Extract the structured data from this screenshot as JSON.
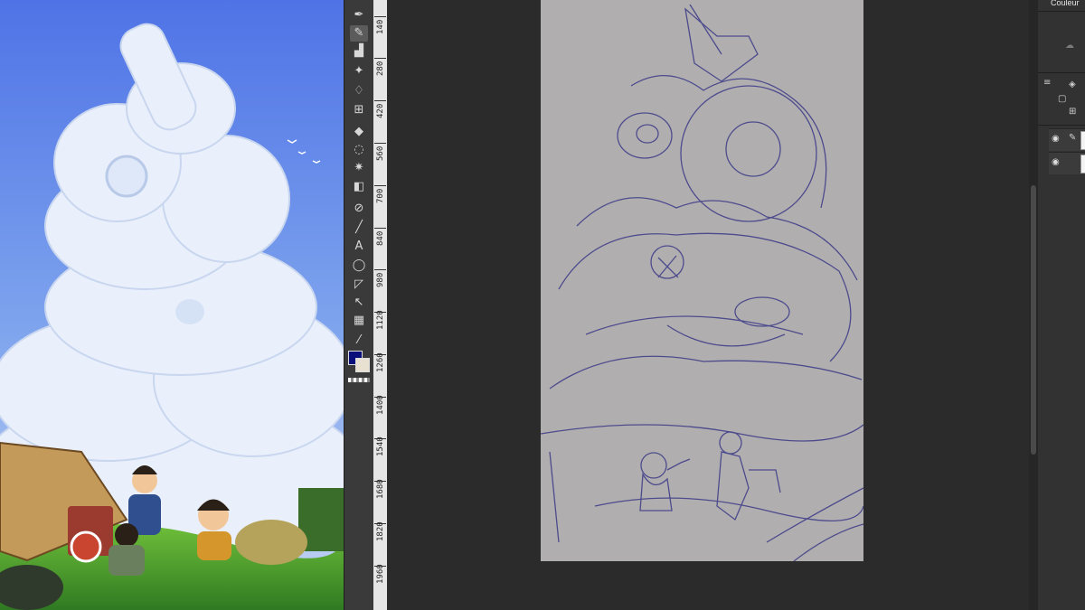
{
  "panel": {
    "tab_label": "Couleur"
  },
  "ruler": {
    "ticks": [
      "140",
      "280",
      "420",
      "560",
      "700",
      "840",
      "980",
      "1120",
      "1260",
      "1400",
      "1540",
      "1680",
      "1820",
      "1960"
    ]
  },
  "colors": {
    "main": "#0b0f7a",
    "sub": "#e8e0d0"
  },
  "icons": {
    "tools": [
      "pen-icon",
      "pencil-icon",
      "brush-icon",
      "airbrush-icon",
      "blend-icon",
      "grid-icon",
      "fill-icon",
      "lasso-icon",
      "magic-wand-icon",
      "gradient-icon",
      "figure-icon",
      "line-icon",
      "text-icon",
      "balloon-icon",
      "frame-icon",
      "operation-icon",
      "tone-icon",
      "eyedropper-icon"
    ],
    "panel": [
      "layers-icon",
      "layer-icon",
      "eye-icon"
    ]
  }
}
